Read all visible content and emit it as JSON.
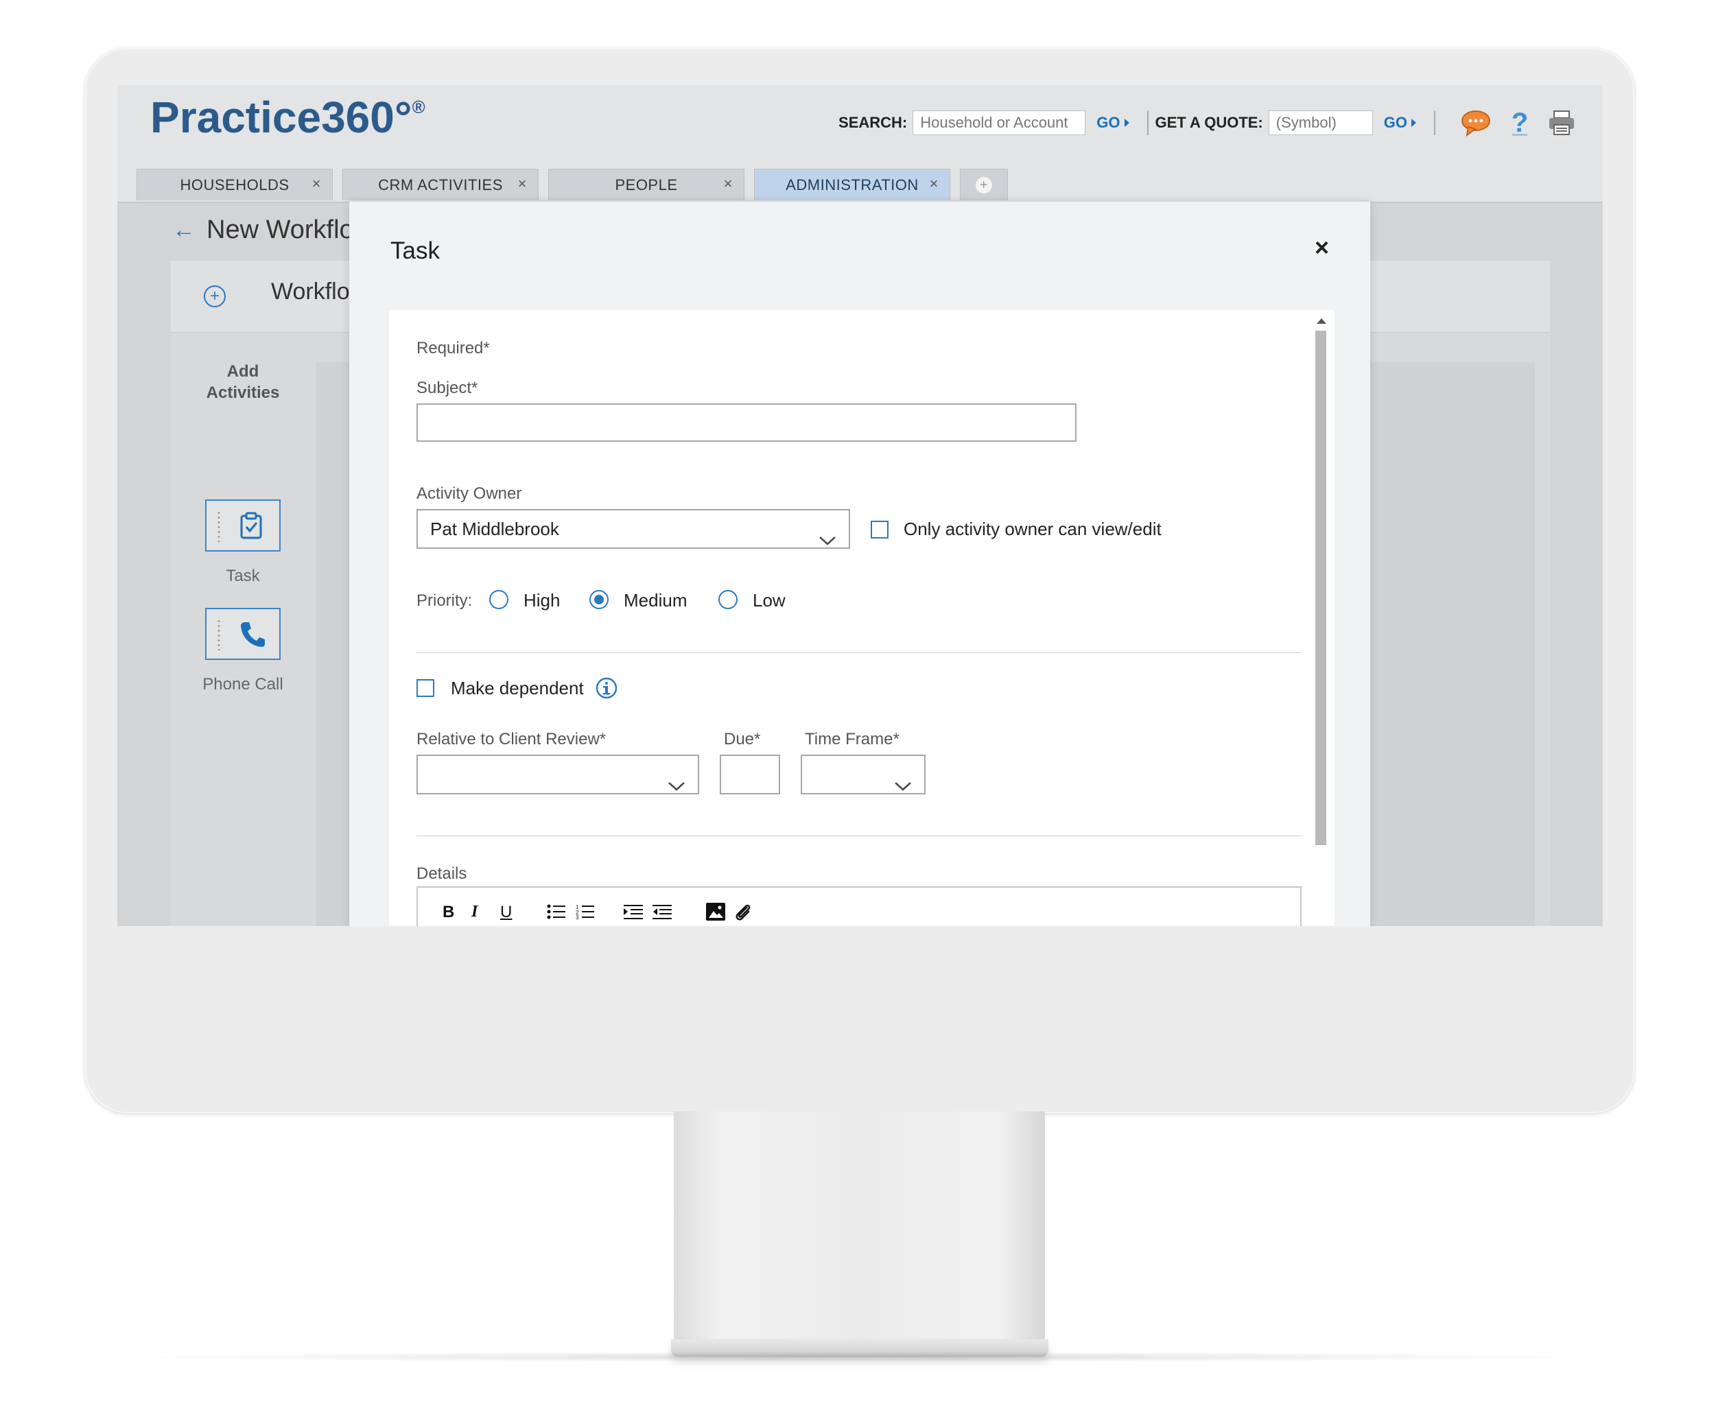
{
  "app": {
    "logo": "Practice360°",
    "logo_mark": "®"
  },
  "header": {
    "search_label": "SEARCH:",
    "search_placeholder": "Household or Account",
    "go_label": "GO",
    "quote_label": "GET A QUOTE:",
    "quote_placeholder": "(Symbol)",
    "go2_label": "GO"
  },
  "tabs": [
    {
      "label": "HOUSEHOLDS",
      "close": "×"
    },
    {
      "label": "CRM ACTIVITIES",
      "close": "×"
    },
    {
      "label": "PEOPLE",
      "close": "×"
    },
    {
      "label": "ADMINISTRATION",
      "close": "×",
      "active": true
    }
  ],
  "tab_add": "+",
  "page": {
    "title": "New Workflov",
    "workflow_name": "Workflo",
    "add_activities": "Add Activities",
    "activities": [
      {
        "label": "Task",
        "icon": "clipboard-check-icon"
      },
      {
        "label": "Phone Call",
        "icon": "phone-icon"
      }
    ]
  },
  "modal": {
    "title": "Task",
    "close": "×",
    "required_note": "Required*",
    "subject_label": "Subject*",
    "subject_value": "",
    "owner_label": "Activity Owner",
    "owner_value": "Pat Middlebrook",
    "owner_only_label": "Only activity owner can view/edit",
    "owner_only_checked": false,
    "priority_label": "Priority:",
    "priority_options": [
      "High",
      "Medium",
      "Low"
    ],
    "priority_selected": "Medium",
    "make_dependent_label": "Make dependent",
    "make_dependent_checked": false,
    "relative_label": "Relative to Client Review*",
    "relative_value": "",
    "due_label": "Due*",
    "due_value": "",
    "timeframe_label": "Time Frame*",
    "timeframe_value": "",
    "details_label": "Details",
    "toolbar": [
      "B",
      "I",
      "U",
      "bulleted-list",
      "numbered-list",
      "indent",
      "outdent",
      "image",
      "attachment"
    ]
  },
  "colors": {
    "accent": "#2a7ac3",
    "brand": "#2b5a8b",
    "active_tab": "#bfd4ea"
  }
}
